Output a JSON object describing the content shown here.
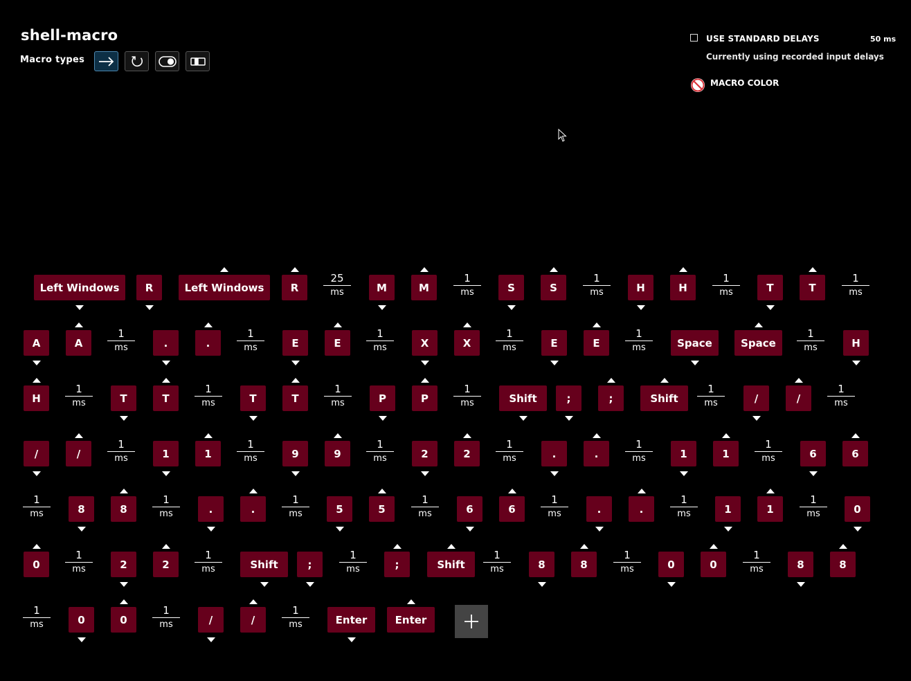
{
  "header": {
    "title": "shell-macro",
    "macro_types_label": "Macro types"
  },
  "macro_types": [
    {
      "name": "no-repeat",
      "icon": "arrow-right-icon",
      "active": true
    },
    {
      "name": "repeat-while-holding",
      "icon": "repeat-icon",
      "active": false
    },
    {
      "name": "toggle",
      "icon": "toggle-icon",
      "active": false
    },
    {
      "name": "sequence",
      "icon": "sequence-icon",
      "active": false
    }
  ],
  "settings": {
    "use_standard_delays_label": "USE STANDARD DELAYS",
    "standard_delay_value": "50 ms",
    "use_standard_delays_checked": false,
    "delay_note": "Currently using recorded input delays",
    "macro_color_label": "MACRO COLOR",
    "macro_color_icon": "no-color-icon"
  },
  "colors": {
    "key_bg": "#66001c",
    "active_type_bg": "#0d2f45",
    "no_color_red": "#d9343b"
  },
  "add_button_icon": "plus-icon",
  "steps": [
    [
      {
        "t": "key",
        "label": "Left Windows",
        "dir": "down"
      },
      {
        "t": "key",
        "label": "R",
        "dir": "down"
      },
      {
        "t": "key",
        "label": "Left Windows",
        "dir": "up"
      },
      {
        "t": "key",
        "label": "R",
        "dir": "up"
      },
      {
        "t": "delay",
        "value": "25",
        "unit": "ms"
      },
      {
        "t": "key",
        "label": "M",
        "dir": "down"
      },
      {
        "t": "key",
        "label": "M",
        "dir": "up"
      },
      {
        "t": "delay",
        "value": "1",
        "unit": "ms"
      },
      {
        "t": "key",
        "label": "S",
        "dir": "down"
      },
      {
        "t": "key",
        "label": "S",
        "dir": "up"
      },
      {
        "t": "delay",
        "value": "1",
        "unit": "ms"
      },
      {
        "t": "key",
        "label": "H",
        "dir": "down"
      },
      {
        "t": "key",
        "label": "H",
        "dir": "up"
      },
      {
        "t": "delay",
        "value": "1",
        "unit": "ms"
      },
      {
        "t": "key",
        "label": "T",
        "dir": "down"
      },
      {
        "t": "key",
        "label": "T",
        "dir": "up"
      },
      {
        "t": "delay",
        "value": "1",
        "unit": "ms"
      }
    ],
    [
      {
        "t": "key",
        "label": "A",
        "dir": "down"
      },
      {
        "t": "key",
        "label": "A",
        "dir": "up"
      },
      {
        "t": "delay",
        "value": "1",
        "unit": "ms"
      },
      {
        "t": "key",
        "label": ".",
        "dir": "down"
      },
      {
        "t": "key",
        "label": ".",
        "dir": "up"
      },
      {
        "t": "delay",
        "value": "1",
        "unit": "ms"
      },
      {
        "t": "key",
        "label": "E",
        "dir": "down"
      },
      {
        "t": "key",
        "label": "E",
        "dir": "up"
      },
      {
        "t": "delay",
        "value": "1",
        "unit": "ms"
      },
      {
        "t": "key",
        "label": "X",
        "dir": "down"
      },
      {
        "t": "key",
        "label": "X",
        "dir": "up"
      },
      {
        "t": "delay",
        "value": "1",
        "unit": "ms"
      },
      {
        "t": "key",
        "label": "E",
        "dir": "down"
      },
      {
        "t": "key",
        "label": "E",
        "dir": "up"
      },
      {
        "t": "delay",
        "value": "1",
        "unit": "ms"
      },
      {
        "t": "key",
        "label": "Space",
        "dir": "down"
      },
      {
        "t": "key",
        "label": "Space",
        "dir": "up"
      },
      {
        "t": "delay",
        "value": "1",
        "unit": "ms"
      },
      {
        "t": "key",
        "label": "H",
        "dir": "down"
      }
    ],
    [
      {
        "t": "key",
        "label": "H",
        "dir": "up"
      },
      {
        "t": "delay",
        "value": "1",
        "unit": "ms"
      },
      {
        "t": "key",
        "label": "T",
        "dir": "down"
      },
      {
        "t": "key",
        "label": "T",
        "dir": "up"
      },
      {
        "t": "delay",
        "value": "1",
        "unit": "ms"
      },
      {
        "t": "key",
        "label": "T",
        "dir": "down"
      },
      {
        "t": "key",
        "label": "T",
        "dir": "up"
      },
      {
        "t": "delay",
        "value": "1",
        "unit": "ms"
      },
      {
        "t": "key",
        "label": "P",
        "dir": "down"
      },
      {
        "t": "key",
        "label": "P",
        "dir": "up"
      },
      {
        "t": "delay",
        "value": "1",
        "unit": "ms"
      },
      {
        "t": "key",
        "label": "Shift",
        "dir": "down"
      },
      {
        "t": "key",
        "label": ";",
        "dir": "down"
      },
      {
        "t": "key",
        "label": ";",
        "dir": "up"
      },
      {
        "t": "key",
        "label": "Shift",
        "dir": "up"
      },
      {
        "t": "delay",
        "value": "1",
        "unit": "ms"
      },
      {
        "t": "key",
        "label": "/",
        "dir": "down"
      },
      {
        "t": "key",
        "label": "/",
        "dir": "up"
      },
      {
        "t": "delay",
        "value": "1",
        "unit": "ms"
      }
    ],
    [
      {
        "t": "key",
        "label": "/",
        "dir": "down"
      },
      {
        "t": "key",
        "label": "/",
        "dir": "up"
      },
      {
        "t": "delay",
        "value": "1",
        "unit": "ms"
      },
      {
        "t": "key",
        "label": "1",
        "dir": "down"
      },
      {
        "t": "key",
        "label": "1",
        "dir": "up"
      },
      {
        "t": "delay",
        "value": "1",
        "unit": "ms"
      },
      {
        "t": "key",
        "label": "9",
        "dir": "down"
      },
      {
        "t": "key",
        "label": "9",
        "dir": "up"
      },
      {
        "t": "delay",
        "value": "1",
        "unit": "ms"
      },
      {
        "t": "key",
        "label": "2",
        "dir": "down"
      },
      {
        "t": "key",
        "label": "2",
        "dir": "up"
      },
      {
        "t": "delay",
        "value": "1",
        "unit": "ms"
      },
      {
        "t": "key",
        "label": ".",
        "dir": "down"
      },
      {
        "t": "key",
        "label": ".",
        "dir": "up"
      },
      {
        "t": "delay",
        "value": "1",
        "unit": "ms"
      },
      {
        "t": "key",
        "label": "1",
        "dir": "down"
      },
      {
        "t": "key",
        "label": "1",
        "dir": "up"
      },
      {
        "t": "delay",
        "value": "1",
        "unit": "ms"
      },
      {
        "t": "key",
        "label": "6",
        "dir": "down"
      },
      {
        "t": "key",
        "label": "6",
        "dir": "up"
      }
    ],
    [
      {
        "t": "delay",
        "value": "1",
        "unit": "ms"
      },
      {
        "t": "key",
        "label": "8",
        "dir": "down"
      },
      {
        "t": "key",
        "label": "8",
        "dir": "up"
      },
      {
        "t": "delay",
        "value": "1",
        "unit": "ms"
      },
      {
        "t": "key",
        "label": ".",
        "dir": "down"
      },
      {
        "t": "key",
        "label": ".",
        "dir": "up"
      },
      {
        "t": "delay",
        "value": "1",
        "unit": "ms"
      },
      {
        "t": "key",
        "label": "5",
        "dir": "down"
      },
      {
        "t": "key",
        "label": "5",
        "dir": "up"
      },
      {
        "t": "delay",
        "value": "1",
        "unit": "ms"
      },
      {
        "t": "key",
        "label": "6",
        "dir": "down"
      },
      {
        "t": "key",
        "label": "6",
        "dir": "up"
      },
      {
        "t": "delay",
        "value": "1",
        "unit": "ms"
      },
      {
        "t": "key",
        "label": ".",
        "dir": "down"
      },
      {
        "t": "key",
        "label": ".",
        "dir": "up"
      },
      {
        "t": "delay",
        "value": "1",
        "unit": "ms"
      },
      {
        "t": "key",
        "label": "1",
        "dir": "down"
      },
      {
        "t": "key",
        "label": "1",
        "dir": "up"
      },
      {
        "t": "delay",
        "value": "1",
        "unit": "ms"
      },
      {
        "t": "key",
        "label": "0",
        "dir": "down"
      }
    ],
    [
      {
        "t": "key",
        "label": "0",
        "dir": "up"
      },
      {
        "t": "delay",
        "value": "1",
        "unit": "ms"
      },
      {
        "t": "key",
        "label": "2",
        "dir": "down"
      },
      {
        "t": "key",
        "label": "2",
        "dir": "up"
      },
      {
        "t": "delay",
        "value": "1",
        "unit": "ms"
      },
      {
        "t": "key",
        "label": "Shift",
        "dir": "down"
      },
      {
        "t": "key",
        "label": ";",
        "dir": "down"
      },
      {
        "t": "delay",
        "value": "1",
        "unit": "ms"
      },
      {
        "t": "key",
        "label": ";",
        "dir": "up"
      },
      {
        "t": "key",
        "label": "Shift",
        "dir": "up"
      },
      {
        "t": "delay",
        "value": "1",
        "unit": "ms"
      },
      {
        "t": "key",
        "label": "8",
        "dir": "down"
      },
      {
        "t": "key",
        "label": "8",
        "dir": "up"
      },
      {
        "t": "delay",
        "value": "1",
        "unit": "ms"
      },
      {
        "t": "key",
        "label": "0",
        "dir": "down"
      },
      {
        "t": "key",
        "label": "0",
        "dir": "up"
      },
      {
        "t": "delay",
        "value": "1",
        "unit": "ms"
      },
      {
        "t": "key",
        "label": "8",
        "dir": "down"
      },
      {
        "t": "key",
        "label": "8",
        "dir": "up"
      }
    ],
    [
      {
        "t": "delay",
        "value": "1",
        "unit": "ms"
      },
      {
        "t": "key",
        "label": "0",
        "dir": "down"
      },
      {
        "t": "key",
        "label": "0",
        "dir": "up"
      },
      {
        "t": "delay",
        "value": "1",
        "unit": "ms"
      },
      {
        "t": "key",
        "label": "/",
        "dir": "down"
      },
      {
        "t": "key",
        "label": "/",
        "dir": "up"
      },
      {
        "t": "delay",
        "value": "1",
        "unit": "ms"
      },
      {
        "t": "key",
        "label": "Enter",
        "dir": "down"
      },
      {
        "t": "key",
        "label": "Enter",
        "dir": "up"
      }
    ]
  ]
}
